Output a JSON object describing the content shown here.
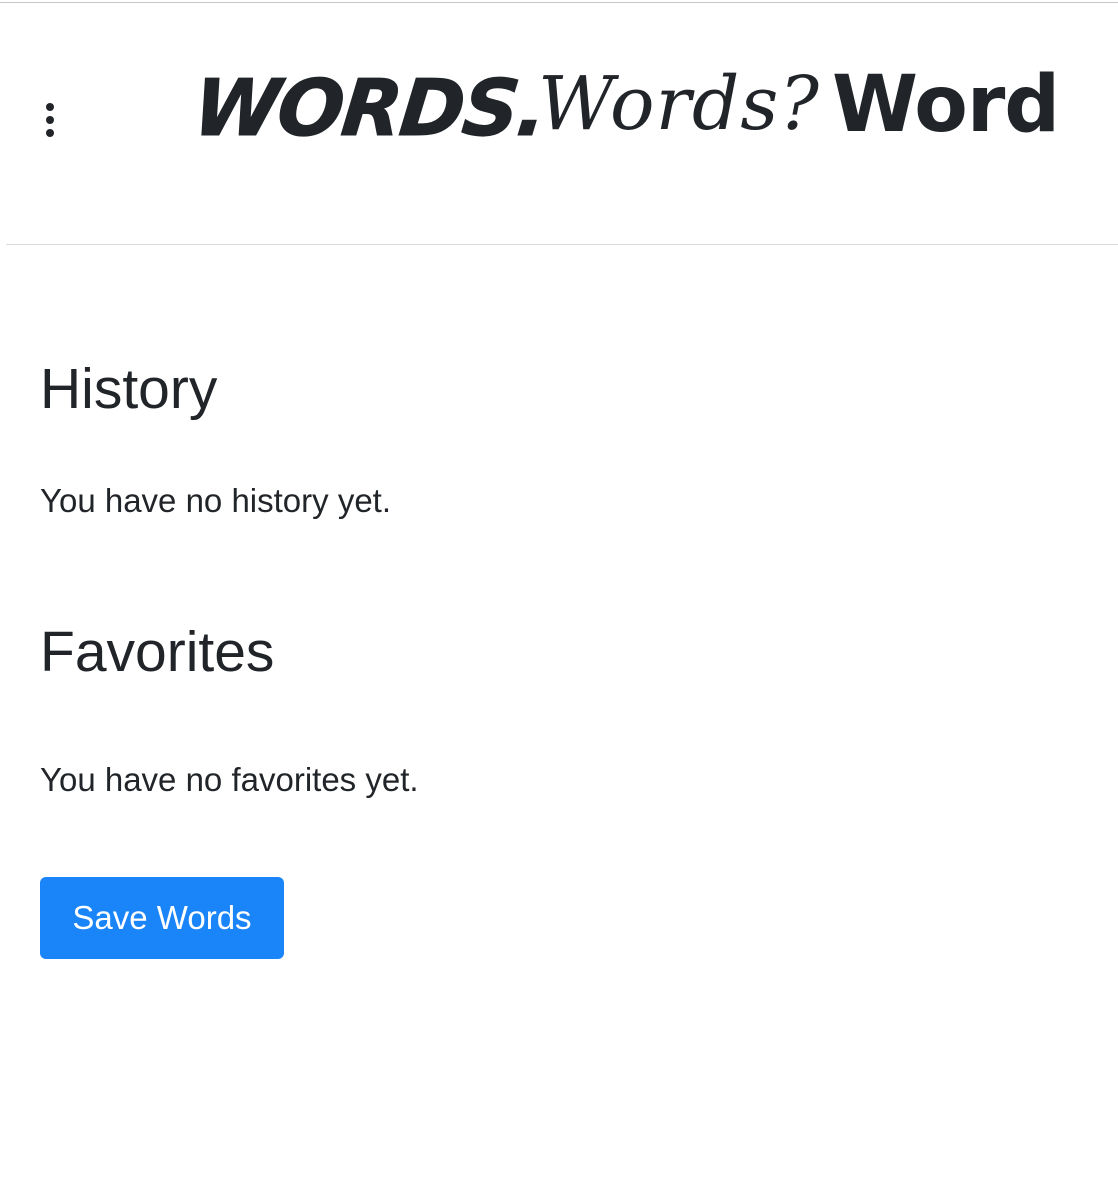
{
  "header": {
    "menu_icon": "kebab-menu-icon",
    "logo": {
      "word1": "WORDS.",
      "word2": "Words?",
      "word3": "Words!"
    }
  },
  "history": {
    "heading": "History",
    "empty_text": "You have no history yet."
  },
  "favorites": {
    "heading": "Favorites",
    "empty_text": "You have no favorites yet."
  },
  "actions": {
    "save_label": "Save Words"
  },
  "colors": {
    "text": "#212529",
    "primary": "#1a84f9",
    "divider": "#d9d9d9"
  }
}
